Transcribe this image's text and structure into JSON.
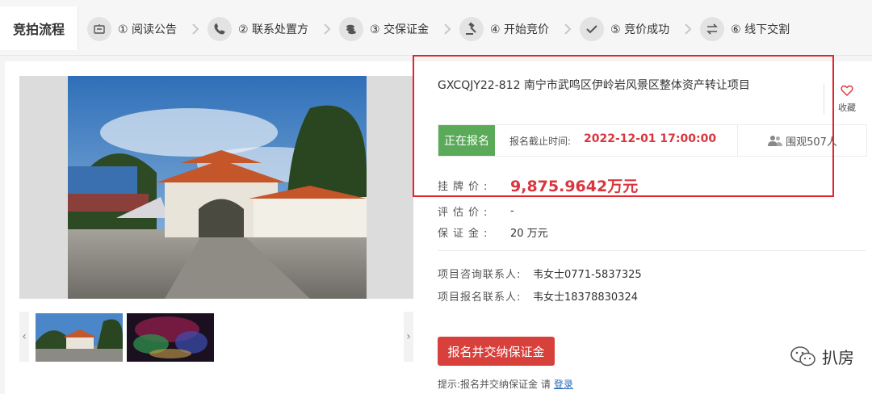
{
  "process": {
    "title": "竞拍流程",
    "steps": [
      {
        "icon": "notice-icon",
        "label": "① 阅读公告"
      },
      {
        "icon": "phone-icon",
        "label": "② 联系处置方"
      },
      {
        "icon": "coins-icon",
        "label": "③ 交保证金"
      },
      {
        "icon": "gavel-icon",
        "label": "④ 开始竞价"
      },
      {
        "icon": "check-icon",
        "label": "⑤ 竞价成功"
      },
      {
        "icon": "exchange-icon",
        "label": "⑥ 线下交割"
      }
    ]
  },
  "gallery": {
    "prev_arrow": "‹",
    "next_arrow": "›"
  },
  "project": {
    "title": "GXCQJY22-812 南宁市武鸣区伊岭岩风景区整体资产转让项目",
    "favorite_label": "收藏",
    "status": "正在报名",
    "deadline_label": "报名截止时间:",
    "deadline_value": "2022-12-01 17:00:00",
    "viewers": "围观507人",
    "price_label": "挂牌价:",
    "price_value": "9,875.9642万元",
    "appraisal_label": "评估价:",
    "appraisal_value": "-",
    "deposit_label": "保证金:",
    "deposit_value": "20 万元",
    "consult_label": "项目咨询联系人:",
    "consult_value": "韦女士0771-5837325",
    "signup_contact_label": "项目报名联系人:",
    "signup_contact_value": "韦女士18378830324",
    "signup_button": "报名并交纳保证金",
    "hint_text": "提示:报名并交纳保证金 请",
    "hint_link": "登录"
  },
  "watermark": {
    "text": "扒房"
  },
  "colors": {
    "accent_red": "#d9363e",
    "status_green": "#5aaa5a",
    "button_red": "#d8403c",
    "annotation_red": "#e3262b",
    "link_blue": "#2a6cc0"
  }
}
